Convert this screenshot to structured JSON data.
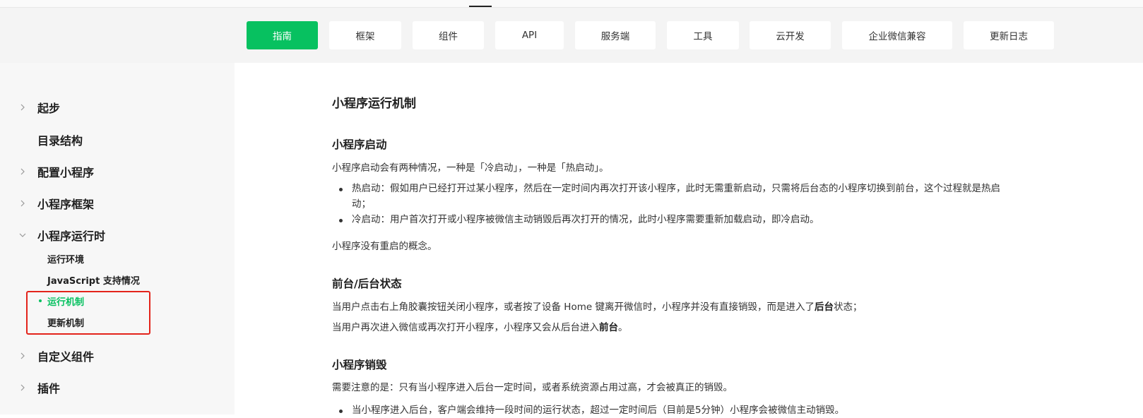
{
  "nav": {
    "tabs": [
      {
        "label": "指南",
        "active": true
      },
      {
        "label": "框架",
        "active": false
      },
      {
        "label": "组件",
        "active": false
      },
      {
        "label": "API",
        "active": false
      },
      {
        "label": "服务端",
        "active": false
      },
      {
        "label": "工具",
        "active": false
      },
      {
        "label": "云开发",
        "active": false
      },
      {
        "label": "企业微信兼容",
        "active": false
      },
      {
        "label": "更新日志",
        "active": false
      }
    ],
    "accent_color": "#07c160"
  },
  "sidebar": {
    "items": [
      {
        "label": "起步",
        "icon": "chevron-right-icon"
      },
      {
        "label": "目录结构",
        "icon": ""
      },
      {
        "label": "配置小程序",
        "icon": "chevron-right-icon"
      },
      {
        "label": "小程序框架",
        "icon": "chevron-right-icon"
      },
      {
        "label": "小程序运行时",
        "icon": "chevron-down-icon"
      },
      {
        "label": "自定义组件",
        "icon": "chevron-right-icon"
      },
      {
        "label": "插件",
        "icon": "chevron-right-icon"
      }
    ],
    "subitems": [
      {
        "label": "运行环境",
        "active": false
      },
      {
        "label": "JavaScript 支持情况",
        "active": false
      },
      {
        "label": "运行机制",
        "active": true
      },
      {
        "label": "更新机制",
        "active": false
      }
    ],
    "highlight_color": "#e3241b"
  },
  "article": {
    "title": "小程序运行机制",
    "sections": {
      "launch": {
        "heading": "小程序启动",
        "intro": "小程序启动会有两种情况，一种是「冷启动」，一种是「热启动」。",
        "hot": "热启动：假如用户已经打开过某小程序，然后在一定时间内再次打开该小程序，此时无需重新启动，只需将后台态的小程序切换到前台，这个过程就是热启动；",
        "cold": "冷启动：用户首次打开或小程序被微信主动销毁后再次打开的情况，此时小程序需要重新加载启动，即冷启动。",
        "note": "小程序没有重启的概念。"
      },
      "state": {
        "heading": "前台/后台状态",
        "line1_prefix": "当用户点击右上角胶囊按钮关闭小程序，或者按了设备 Home 键离开微信时，小程序并没有直接销毁，而是进入了",
        "line1_bold": "后台",
        "line1_suffix": "状态；",
        "line2_prefix": "当用户再次进入微信或再次打开小程序，小程序又会从后台进入",
        "line2_bold": "前台",
        "line2_suffix": "。"
      },
      "destroy": {
        "heading": "小程序销毁",
        "intro": "需要注意的是：只有当小程序进入后台一定时间，或者系统资源占用过高，才会被真正的销毁。",
        "item1": "当小程序进入后台，客户端会维持一段时间的运行状态，超过一定时间后（目前是5分钟）小程序会被微信主动销毁。"
      }
    }
  }
}
